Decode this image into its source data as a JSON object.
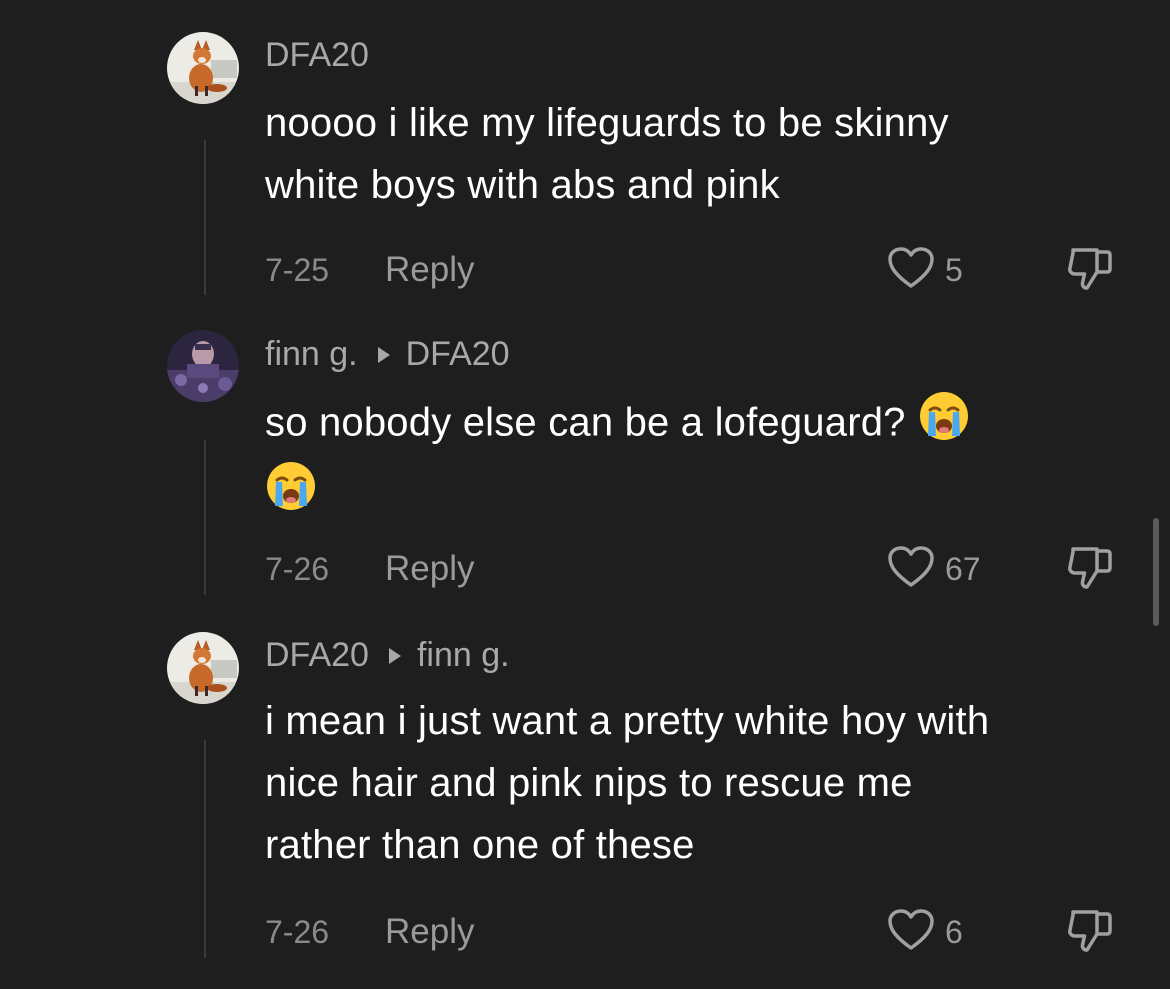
{
  "comments": [
    {
      "username": "DFA20",
      "reply_to": "",
      "text_lines": [
        "noooo i like my lifeguards to be skinny",
        "white boys with abs and pink"
      ],
      "date": "7-25",
      "reply_label": "Reply",
      "likes": "5",
      "avatar": "fox-avatar"
    },
    {
      "username": "finn g.",
      "reply_to": "DFA20",
      "text_lines": [
        "so nobody else can be a lofeguard?"
      ],
      "emoji": "loudly-crying-face",
      "date": "7-26",
      "reply_label": "Reply",
      "likes": "67",
      "avatar": "purple-photo-avatar"
    },
    {
      "username": "DFA20",
      "reply_to": "finn g.",
      "text_lines": [
        "i mean i just want a pretty white hoy with",
        "nice hair and pink nips to rescue me",
        "rather than one of these"
      ],
      "date": "7-26",
      "reply_label": "Reply",
      "likes": "6",
      "avatar": "fox-avatar"
    }
  ],
  "icons": {
    "like": "heart-outline-icon",
    "dislike": "thumbs-down-outline-icon",
    "reply_to": "triangle-right-icon"
  },
  "colors": {
    "background": "#1e1e1e",
    "text_primary": "#ffffff",
    "text_secondary": "#a8a8a8",
    "thread_line": "#3a3a3a"
  }
}
